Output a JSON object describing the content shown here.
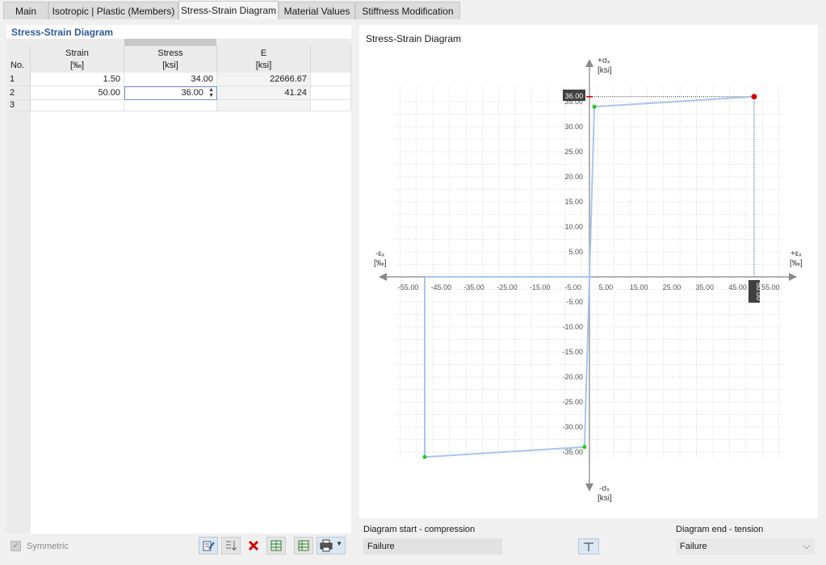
{
  "tabs": [
    {
      "label": "Main",
      "active": false
    },
    {
      "label": "Isotropic | Plastic (Members)",
      "active": false
    },
    {
      "label": "Stress-Strain Diagram",
      "active": true
    },
    {
      "label": "Material Values",
      "active": false
    },
    {
      "label": "Stiffness Modification",
      "active": false
    }
  ],
  "table": {
    "title": "Stress-Strain Diagram",
    "columns": [
      {
        "label": "No.",
        "unit": ""
      },
      {
        "label": "Strain",
        "unit": "[‰]"
      },
      {
        "label": "Stress",
        "unit": "[ksi]"
      },
      {
        "label": "E",
        "unit": "[ksi]"
      }
    ],
    "rows": [
      {
        "no": "1",
        "strain": "1.50",
        "stress": "34.00",
        "e": "22666.67"
      },
      {
        "no": "2",
        "strain": "50.00",
        "stress": "36.00",
        "e": "41.24"
      },
      {
        "no": "3",
        "strain": "",
        "stress": "",
        "e": ""
      }
    ]
  },
  "symmetric": {
    "label": "Symmetric",
    "checked": true
  },
  "toolbar": {
    "icons": [
      "edit-icon",
      "sort-icon",
      "delete-icon",
      "export-icon",
      "import-icon",
      "print-icon"
    ]
  },
  "diagram": {
    "title": "Stress-Strain Diagram",
    "y_pos_label": "+σₓ",
    "y_neg_label": "-σₓ",
    "y_unit": "[ksi]",
    "x_pos_label": "+εₓ",
    "x_neg_label": "-εₓ",
    "x_unit": "[‰]",
    "highlight_stress": "36.00",
    "highlight_strain": "50.00",
    "colors": {
      "curve": "#a7c6ec",
      "point": "#22cc22",
      "selected": "#d40000",
      "grid": "#c9c9c9"
    }
  },
  "chart_data": {
    "type": "line",
    "x": [
      -50.0,
      -1.5,
      0,
      1.5,
      50.0
    ],
    "y": [
      -36.0,
      -34.0,
      0,
      34.0,
      36.0
    ],
    "xlim": [
      -60,
      60
    ],
    "ylim": [
      -40,
      40
    ],
    "x_ticks": [
      "-55.00",
      "-45.00",
      "-35.00",
      "-25.00",
      "-15.00",
      "-5.00",
      "5.00",
      "15.00",
      "25.00",
      "35.00",
      "45.00",
      "55.00"
    ],
    "y_ticks": [
      "35.00",
      "30.00",
      "25.00",
      "20.00",
      "15.00",
      "10.00",
      "5.00",
      "-5.00",
      "-10.00",
      "-15.00",
      "-20.00",
      "-25.00",
      "-30.00",
      "-35.00"
    ],
    "selected_point": [
      50.0,
      36.0
    ],
    "grid": true
  },
  "fields": {
    "start_label": "Diagram start - compression",
    "start_value": "Failure",
    "end_label": "Diagram end - tension",
    "end_value": "Failure"
  }
}
